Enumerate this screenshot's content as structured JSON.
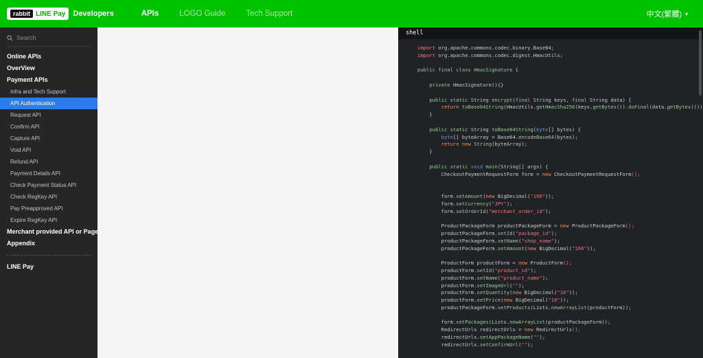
{
  "colors": {
    "brand_green": "#00c300",
    "sidebar_bg": "#262626",
    "active_item_blue": "#2b7de9",
    "code_bg": "#202225",
    "code_string_red": "#f2777a",
    "code_keyword_green": "#99cc99",
    "code_new_orange": "#f99157",
    "code_type_blue": "#6699cc"
  },
  "header": {
    "logo": {
      "rabbit": "rabbit",
      "linepay": "LINE Pay",
      "developers": "Developers"
    },
    "nav": [
      {
        "label": "APIs",
        "active": true
      },
      {
        "label": "LOGO Guide",
        "active": false
      },
      {
        "label": "Tech Support",
        "active": false
      }
    ],
    "language": "中文(繁體)",
    "caret": "▾"
  },
  "sidebar": {
    "search_placeholder": "Search",
    "items": [
      {
        "type": "section",
        "label": "Online APIs"
      },
      {
        "type": "section",
        "label": "OverView"
      },
      {
        "type": "section",
        "label": "Payment APIs"
      },
      {
        "type": "sub",
        "label": "Infra and Tech Support"
      },
      {
        "type": "sub",
        "label": "API Authentication",
        "active": true
      },
      {
        "type": "sub",
        "label": "Request API"
      },
      {
        "type": "sub",
        "label": "Confirm API"
      },
      {
        "type": "sub",
        "label": "Capture API"
      },
      {
        "type": "sub",
        "label": "Void API"
      },
      {
        "type": "sub",
        "label": "Refund API"
      },
      {
        "type": "sub",
        "label": "Payment Details API"
      },
      {
        "type": "sub",
        "label": "Check Payment Status API"
      },
      {
        "type": "sub",
        "label": "Check RegKey API"
      },
      {
        "type": "sub",
        "label": "Pay Preapproved API"
      },
      {
        "type": "sub",
        "label": "Expire RegKey API"
      },
      {
        "type": "section",
        "label": "Merchant provided API or Page"
      },
      {
        "type": "section",
        "label": "Appendix"
      },
      {
        "type": "divider"
      },
      {
        "type": "section",
        "label": "LINE Pay"
      }
    ]
  },
  "code_panel": {
    "language_tab": "shell",
    "lines": [
      [
        [
          "r",
          "import "
        ],
        [
          "w",
          "org.apache.commons.codec.binary.Base64;"
        ]
      ],
      [
        [
          "r",
          "import "
        ],
        [
          "w",
          "org.apache.commons.codec.digest.HmacUtils;"
        ]
      ],
      [],
      [
        [
          "g",
          "public final class HmacSignature"
        ],
        [
          "w",
          " {"
        ]
      ],
      [],
      [
        [
          "w",
          "    "
        ],
        [
          "g",
          "private "
        ],
        [
          "w",
          "HmacSignature(){}"
        ]
      ],
      [],
      [
        [
          "w",
          "    "
        ],
        [
          "g",
          "public static "
        ],
        [
          "w",
          "String "
        ],
        [
          "g",
          "encrypt"
        ],
        [
          "w",
          "("
        ],
        [
          "g",
          "final "
        ],
        [
          "w",
          "String keys, "
        ],
        [
          "g",
          "final "
        ],
        [
          "w",
          "String data) {"
        ]
      ],
      [
        [
          "w",
          "        "
        ],
        [
          "o",
          "return "
        ],
        [
          "g",
          "toBase64String"
        ],
        [
          "w",
          "(HmacUtils."
        ],
        [
          "g",
          "getHmacSha256"
        ],
        [
          "w",
          "(keys."
        ],
        [
          "g",
          "getBytes"
        ],
        [
          "w",
          "())."
        ],
        [
          "g",
          "doFinal"
        ],
        [
          "w",
          "(data."
        ],
        [
          "g",
          "getBytes"
        ],
        [
          "w",
          "()));"
        ]
      ],
      [
        [
          "w",
          "    }"
        ]
      ],
      [],
      [
        [
          "w",
          "    "
        ],
        [
          "g",
          "public static "
        ],
        [
          "w",
          "String "
        ],
        [
          "g",
          "toBase64String"
        ],
        [
          "w",
          "("
        ],
        [
          "b",
          "byte"
        ],
        [
          "w",
          "[] bytes) {"
        ]
      ],
      [
        [
          "w",
          "        "
        ],
        [
          "b",
          "byte"
        ],
        [
          "w",
          "[] byteArray = Base64."
        ],
        [
          "g",
          "encodeBase64"
        ],
        [
          "w",
          "(bytes);"
        ]
      ],
      [
        [
          "w",
          "        "
        ],
        [
          "o",
          "return new "
        ],
        [
          "g",
          "String"
        ],
        [
          "w",
          "(byteArray);"
        ]
      ],
      [
        [
          "w",
          "    }"
        ]
      ],
      [],
      [
        [
          "w",
          "    "
        ],
        [
          "g",
          "public static "
        ],
        [
          "b",
          "void "
        ],
        [
          "g",
          "main"
        ],
        [
          "w",
          "(String[] args) {"
        ]
      ],
      [
        [
          "w",
          "        CheckoutPaymentRequestForm form = "
        ],
        [
          "o",
          "new "
        ],
        [
          "w",
          "CheckoutPaymentRequestForm"
        ],
        [
          "r",
          "();"
        ]
      ],
      [],
      [],
      [
        [
          "w",
          "        form."
        ],
        [
          "g",
          "setAmount"
        ],
        [
          "w",
          "("
        ],
        [
          "o",
          "new "
        ],
        [
          "w",
          "BigDecimal("
        ],
        [
          "r",
          "\"100\""
        ],
        [
          "w",
          "));"
        ]
      ],
      [
        [
          "w",
          "        form."
        ],
        [
          "g",
          "setCurrency"
        ],
        [
          "w",
          "("
        ],
        [
          "r",
          "\"JPY\""
        ],
        [
          "w",
          ");"
        ]
      ],
      [
        [
          "w",
          "        form."
        ],
        [
          "g",
          "setOrderId"
        ],
        [
          "w",
          "("
        ],
        [
          "r",
          "\"merchant_order_id\""
        ],
        [
          "w",
          ");"
        ]
      ],
      [],
      [
        [
          "w",
          "        ProductPackageForm productPackageForm = "
        ],
        [
          "o",
          "new "
        ],
        [
          "w",
          "ProductPackageForm"
        ],
        [
          "r",
          "();"
        ]
      ],
      [
        [
          "w",
          "        productPackageForm."
        ],
        [
          "g",
          "setId"
        ],
        [
          "w",
          "("
        ],
        [
          "r",
          "\"package_id\""
        ],
        [
          "w",
          ");"
        ]
      ],
      [
        [
          "w",
          "        productPackageForm."
        ],
        [
          "g",
          "setName"
        ],
        [
          "w",
          "("
        ],
        [
          "r",
          "\"shop_name\""
        ],
        [
          "w",
          ");"
        ]
      ],
      [
        [
          "w",
          "        productPackageForm."
        ],
        [
          "g",
          "setAmount"
        ],
        [
          "w",
          "("
        ],
        [
          "o",
          "new "
        ],
        [
          "w",
          "BigDecimal("
        ],
        [
          "r",
          "\"100\""
        ],
        [
          "w",
          "));"
        ]
      ],
      [],
      [
        [
          "w",
          "        ProductForm productForm = "
        ],
        [
          "o",
          "new "
        ],
        [
          "w",
          "ProductForm"
        ],
        [
          "r",
          "();"
        ]
      ],
      [
        [
          "w",
          "        productForm."
        ],
        [
          "g",
          "setId"
        ],
        [
          "w",
          "("
        ],
        [
          "r",
          "\"product_id\""
        ],
        [
          "w",
          ");"
        ]
      ],
      [
        [
          "w",
          "        productForm."
        ],
        [
          "g",
          "setName"
        ],
        [
          "w",
          "("
        ],
        [
          "r",
          "\"product_name\""
        ],
        [
          "w",
          ");"
        ]
      ],
      [
        [
          "w",
          "        productForm."
        ],
        [
          "g",
          "setImageUrl"
        ],
        [
          "w",
          "("
        ],
        [
          "r",
          "\"\""
        ],
        [
          "w",
          ");"
        ]
      ],
      [
        [
          "w",
          "        productForm."
        ],
        [
          "g",
          "setQuantity"
        ],
        [
          "w",
          "("
        ],
        [
          "o",
          "new "
        ],
        [
          "w",
          "BigDecimal("
        ],
        [
          "r",
          "\"10\""
        ],
        [
          "w",
          "));"
        ]
      ],
      [
        [
          "w",
          "        productForm."
        ],
        [
          "g",
          "setPrice"
        ],
        [
          "w",
          "("
        ],
        [
          "o",
          "new "
        ],
        [
          "w",
          "BigDecimal("
        ],
        [
          "r",
          "\"10\""
        ],
        [
          "w",
          "));"
        ]
      ],
      [
        [
          "w",
          "        productPackageForm."
        ],
        [
          "g",
          "setProducts"
        ],
        [
          "w",
          "(Lists."
        ],
        [
          "g",
          "newArrayList"
        ],
        [
          "w",
          "(productForm));"
        ]
      ],
      [],
      [
        [
          "w",
          "        form."
        ],
        [
          "g",
          "setPackages"
        ],
        [
          "w",
          "(Lists."
        ],
        [
          "g",
          "newArrayList"
        ],
        [
          "w",
          "(productPackageForm));"
        ]
      ],
      [
        [
          "w",
          "        RedirectUrls redirectUrls = "
        ],
        [
          "o",
          "new "
        ],
        [
          "w",
          "RedirectUrls"
        ],
        [
          "r",
          "();"
        ]
      ],
      [
        [
          "w",
          "        redirectUrls."
        ],
        [
          "g",
          "setAppPackageName"
        ],
        [
          "w",
          "("
        ],
        [
          "r",
          "\"\""
        ],
        [
          "w",
          ");"
        ]
      ],
      [
        [
          "w",
          "        redirectUrls."
        ],
        [
          "g",
          "setConfirmUrl"
        ],
        [
          "w",
          "("
        ],
        [
          "r",
          "\"\""
        ],
        [
          "w",
          ");"
        ]
      ]
    ]
  }
}
